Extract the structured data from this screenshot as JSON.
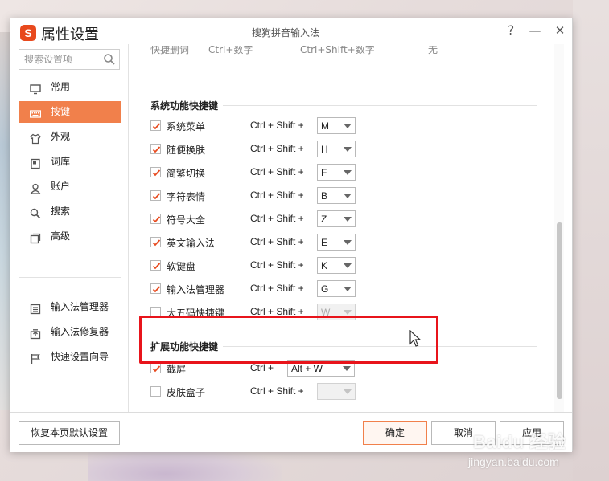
{
  "window": {
    "app_title": "属性设置",
    "center_title": "搜狗拼音输入法",
    "help": "?",
    "minimize": "—",
    "close": "✕",
    "logo_letter": "S"
  },
  "search": {
    "placeholder": "搜索设置项"
  },
  "nav": [
    {
      "label": "常用",
      "icon": "monitor-icon",
      "active": false
    },
    {
      "label": "按键",
      "icon": "keyboard-icon",
      "active": true
    },
    {
      "label": "外观",
      "icon": "shirt-icon",
      "active": false
    },
    {
      "label": "词库",
      "icon": "book-icon",
      "active": false
    },
    {
      "label": "账户",
      "icon": "user-icon",
      "active": false
    },
    {
      "label": "搜索",
      "icon": "search-icon",
      "active": false
    },
    {
      "label": "高级",
      "icon": "advanced-icon",
      "active": false
    }
  ],
  "nav_tools": [
    {
      "label": "输入法管理器",
      "icon": "manager-icon"
    },
    {
      "label": "输入法修复器",
      "icon": "repair-icon"
    },
    {
      "label": "快速设置向导",
      "icon": "flag-icon"
    }
  ],
  "cut_row": {
    "label": "快捷删词",
    "opt1": "Ctrl+数字",
    "opt2": "Ctrl+Shift+数字",
    "opt3": "无"
  },
  "system_section": {
    "title": "系统功能快捷键",
    "modifier": "Ctrl + Shift +",
    "rows": [
      {
        "label": "系统菜单",
        "key": "M",
        "checked": true
      },
      {
        "label": "随便换肤",
        "key": "H",
        "checked": true
      },
      {
        "label": "简繁切换",
        "key": "F",
        "checked": true
      },
      {
        "label": "字符表情",
        "key": "B",
        "checked": true
      },
      {
        "label": "符号大全",
        "key": "Z",
        "checked": true
      },
      {
        "label": "英文输入法",
        "key": "E",
        "checked": true
      },
      {
        "label": "软键盘",
        "key": "K",
        "checked": true
      },
      {
        "label": "输入法管理器",
        "key": "G",
        "checked": true
      },
      {
        "label": "大五码快捷键",
        "key": "W",
        "checked": false
      }
    ]
  },
  "ext_section": {
    "title": "扩展功能快捷键",
    "rows": [
      {
        "label": "截屏",
        "modifier": "Ctrl +",
        "key": "Alt + W",
        "checked": true
      },
      {
        "label": "皮肤盒子",
        "modifier": "Ctrl + Shift +",
        "key": "",
        "checked": false
      }
    ]
  },
  "footer": {
    "restore": "恢复本页默认设置",
    "ok": "确定",
    "cancel": "取消",
    "apply": "应用"
  },
  "watermark": {
    "logo": "Baidu 经验",
    "url": "jingyan.baidu.com"
  },
  "colors": {
    "accent": "#f1804b",
    "highlight": "#e8141b",
    "check": "#e8491d",
    "logo": "#e8491d"
  }
}
